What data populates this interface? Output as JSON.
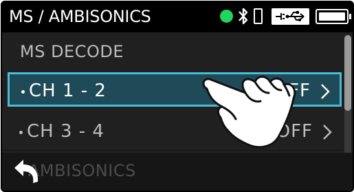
{
  "header": {
    "title": "MS / AMBISONICS",
    "status_icons": [
      "status-dot",
      "bluetooth-icon",
      "phone-icon",
      "usb-power-icon",
      "battery-icon"
    ],
    "status_dot_color": "#21d35f"
  },
  "list": {
    "section_header": "MS DECODE",
    "rows": [
      {
        "label": "CH 1 - 2",
        "value": "OFF",
        "selected": true
      },
      {
        "label": "CH 3 - 4",
        "value": "OFF",
        "selected": false
      }
    ]
  },
  "footer": {
    "label": "AMBISONICS"
  },
  "colors": {
    "background": "#202020",
    "header": "#000000",
    "selection_fill": "#1f4a57",
    "selection_border": "#48bfd8"
  }
}
